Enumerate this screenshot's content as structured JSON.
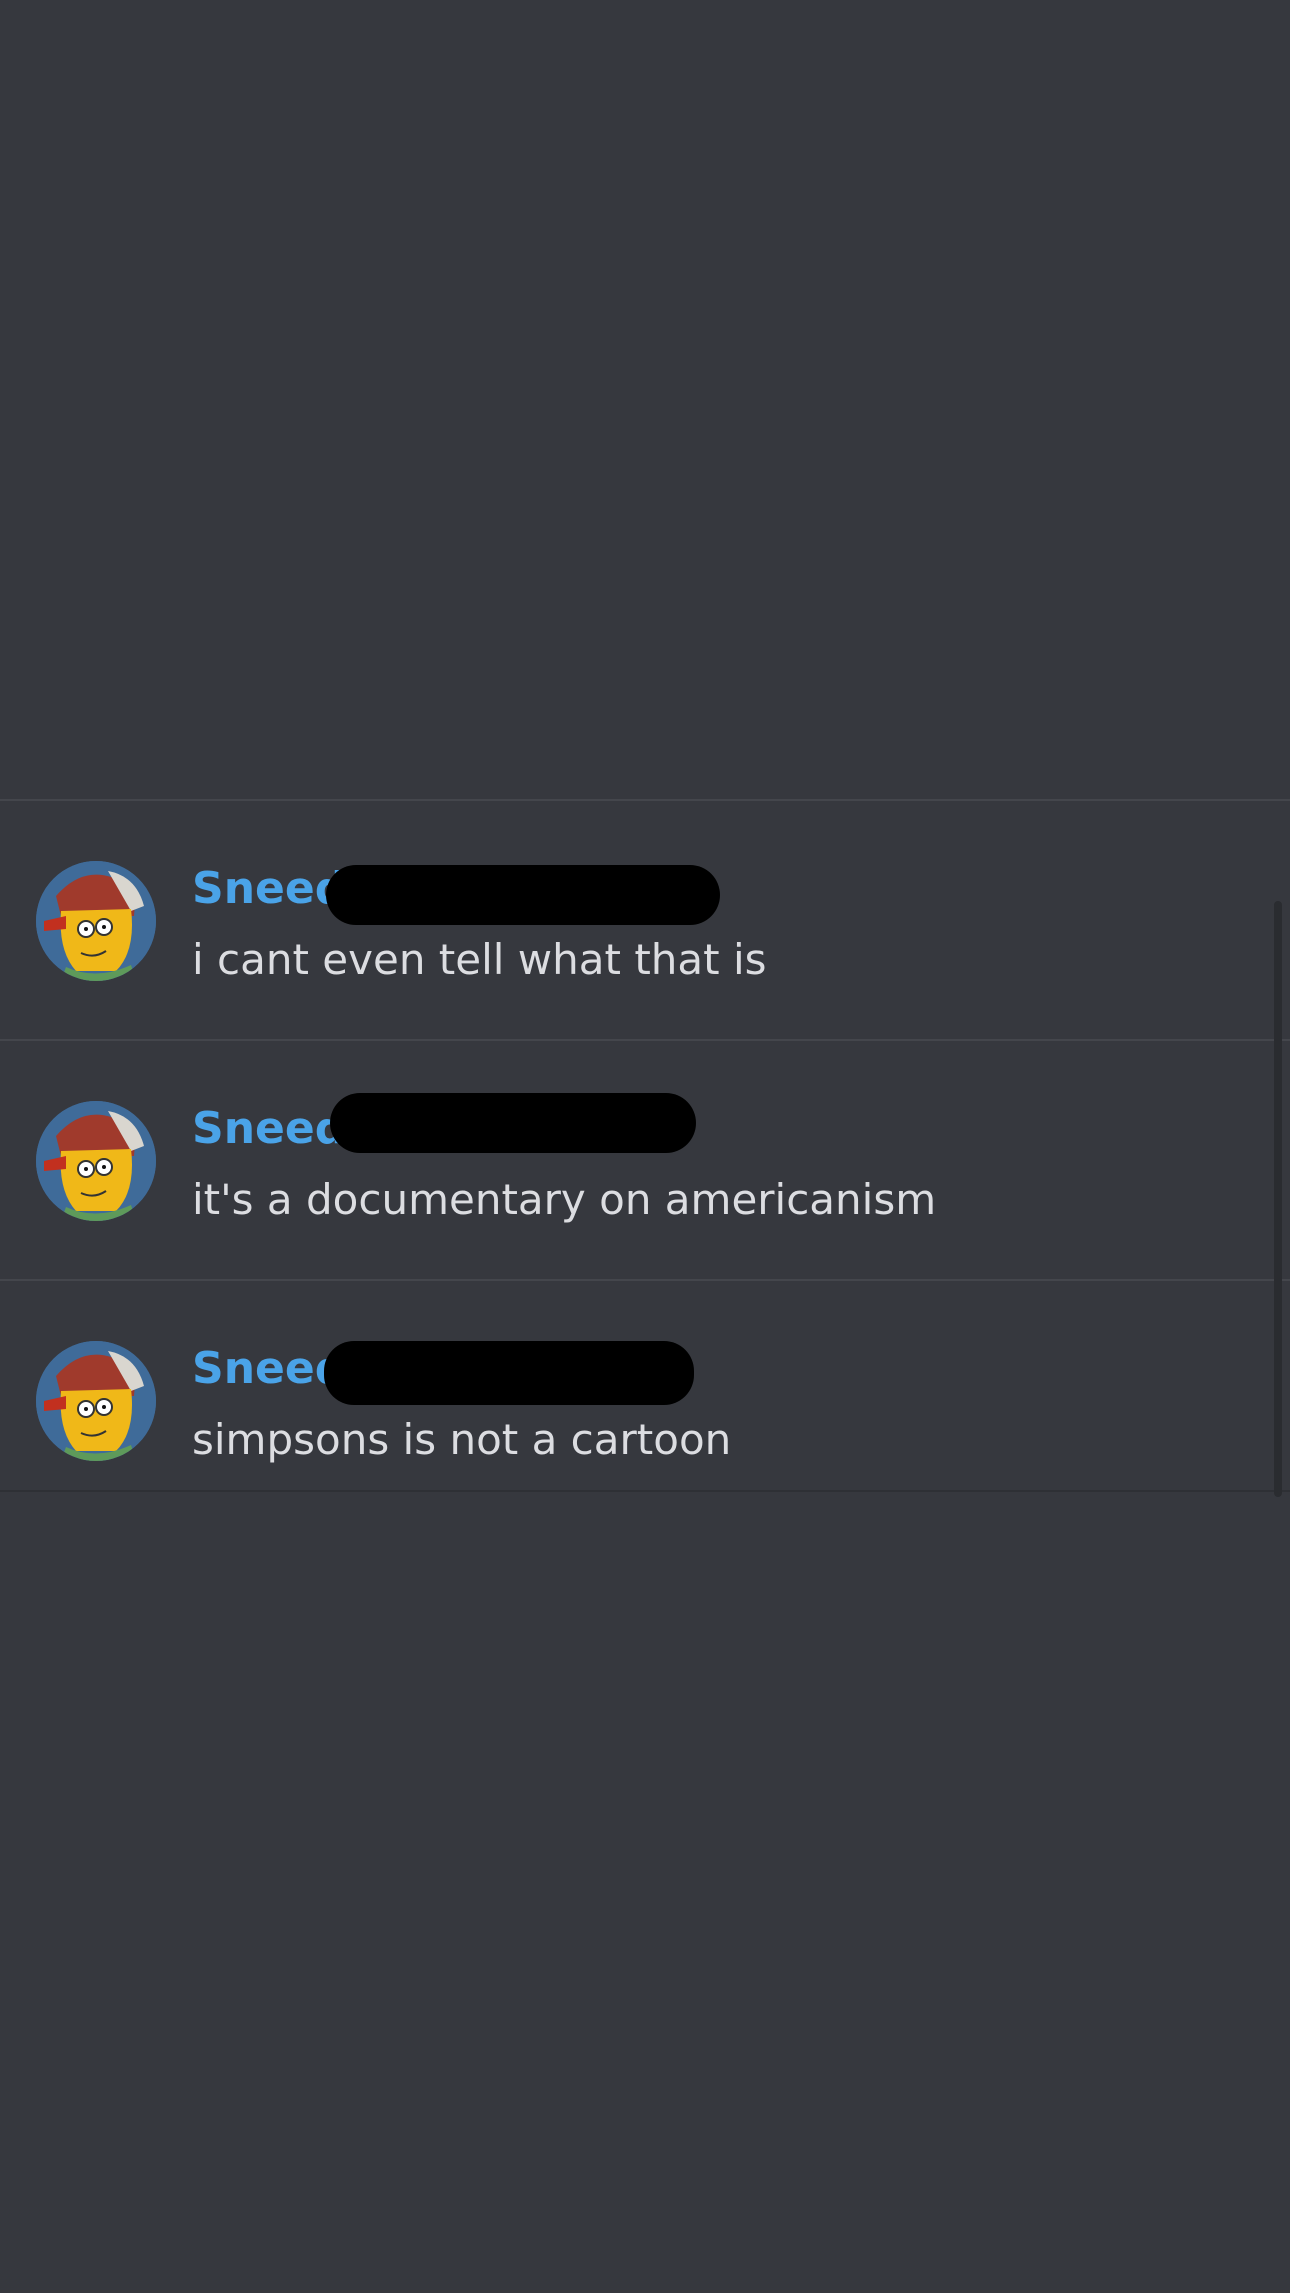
{
  "messages": [
    {
      "author": "Sneed",
      "text": "i cant even tell what that is",
      "avatar_icon": "simpsons-character-avatar"
    },
    {
      "author": "Sneed",
      "text": "it's a documentary on americanism",
      "avatar_icon": "simpsons-character-avatar"
    },
    {
      "author": "Sneed",
      "text": "simpsons is not a cartoon",
      "avatar_icon": "simpsons-character-avatar"
    }
  ],
  "colors": {
    "background": "#36383e",
    "author_name": "#4aa3e8",
    "message_text": "#dcdde1",
    "redaction": "#000000"
  }
}
